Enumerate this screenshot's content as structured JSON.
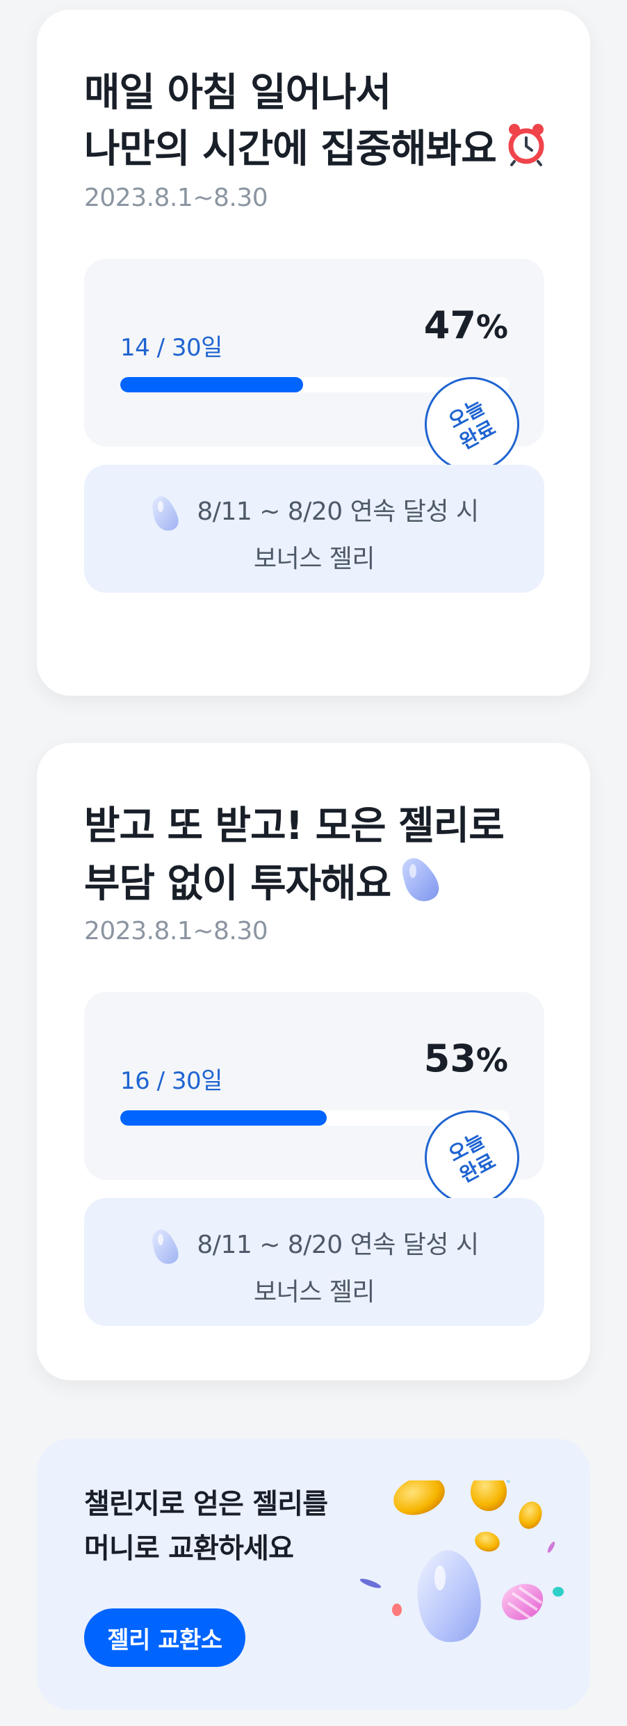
{
  "challenges": [
    {
      "title_line1": "매일 아침 일어나서",
      "title_line2": "나만의 시간에 집중해봐요",
      "title_emoji": "alarm-clock-icon",
      "date_range": "2023.8.1~8.30",
      "count_text": "14 / 30일",
      "percent_value": "47",
      "percent_sign": "%",
      "progress": 0.47,
      "stamp_text": "오늘 완료",
      "bonus_line1": "8/11 ~ 8/20 연속 달성 시",
      "bonus_line2": "보너스 젤리"
    },
    {
      "title_line1": "받고 또 받고! 모은 젤리로",
      "title_line2": "부담 없이 투자해요",
      "title_emoji": "jelly-bean-icon",
      "date_range": "2023.8.1~8.30",
      "count_text": "16 / 30일",
      "percent_value": "53",
      "percent_sign": "%",
      "progress": 0.53,
      "stamp_text": "오늘 완료",
      "bonus_line1": "8/11 ~ 8/20 연속 달성 시",
      "bonus_line2": "보너스 젤리"
    }
  ],
  "exchange": {
    "line1": "챌린지로 얻은 젤리를",
    "line2": "머니로 교환하세요",
    "button_label": "젤리 교환소"
  },
  "colors": {
    "accent": "#0064ff",
    "accent_text": "#1f64d1",
    "card_bg": "#ffffff",
    "bonus_bg": "#ebf1fd",
    "progress_box_bg": "#f4f6f9"
  }
}
